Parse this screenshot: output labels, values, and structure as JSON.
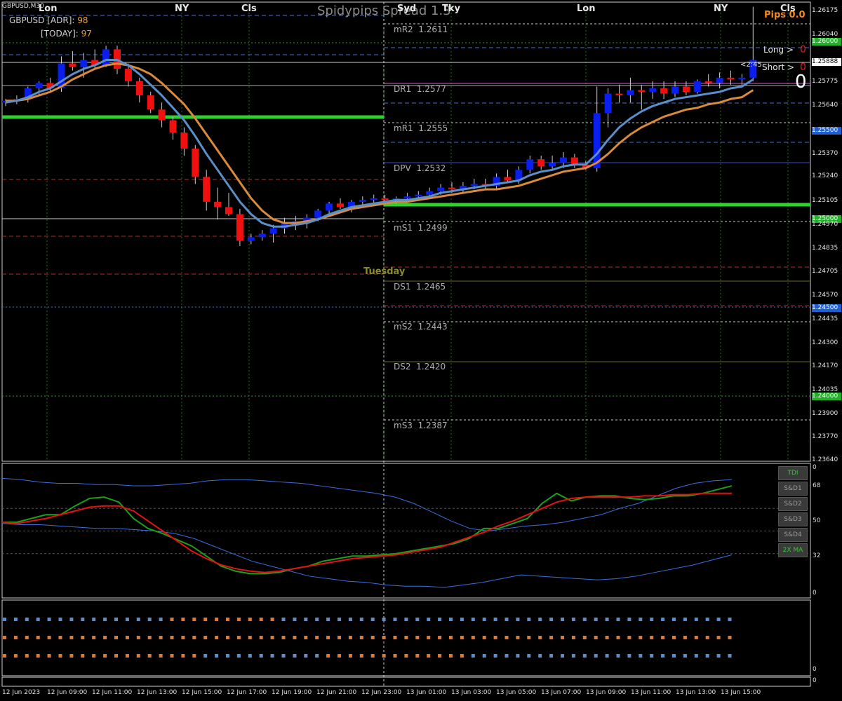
{
  "header": {
    "symbol": "GBPUSD,M30",
    "adr_label": "GBPUSD [ADR]:",
    "adr_value": "98",
    "today_label": "[TODAY]:",
    "today_value": "97",
    "title": "Spidypips Spread 1.3",
    "pips": "Pips 0.0"
  },
  "sessions": [
    "Lon",
    "NY",
    "Cls",
    "Syd",
    "Tky",
    "Lon",
    "NY",
    "Cls"
  ],
  "day_label": "Tuesday",
  "levels": [
    {
      "name": "mR2",
      "value": "1.2611"
    },
    {
      "name": "DR1",
      "value": "1.2577"
    },
    {
      "name": "mR1",
      "value": "1.2555"
    },
    {
      "name": "DPV",
      "value": "1.2532"
    },
    {
      "name": "mS1",
      "value": "1.2499"
    },
    {
      "name": "DS1",
      "value": "1.2465"
    },
    {
      "name": "mS2",
      "value": "1.2443"
    },
    {
      "name": "DS2",
      "value": "1.2420"
    },
    {
      "name": "mS3",
      "value": "1.2387"
    }
  ],
  "trade_panel": {
    "long_label": "Long >",
    "long_value": "0",
    "short_label": "Short >",
    "short_value": "0",
    "timer": "<2:45",
    "big_zero": "0"
  },
  "price_axis": [
    "1.26175",
    "1.26040",
    "1.26000",
    "1.25888",
    "1.25775",
    "1.25640",
    "1.25500",
    "1.25370",
    "1.25240",
    "1.25105",
    "1.25000",
    "1.24970",
    "1.24835",
    "1.24705",
    "1.24570",
    "1.24500",
    "1.24435",
    "1.24300",
    "1.24170",
    "1.24035",
    "1.24000",
    "1.23900",
    "1.23770",
    "1.23640"
  ],
  "price_axis_highlights": {
    "1.26000": "green",
    "1.25888": "white",
    "1.25500": "blue",
    "1.25000": "green",
    "1.24500": "blue",
    "1.24000": "green"
  },
  "time_axis": [
    "12 Jun 2023",
    "12 Jun 09:00",
    "12 Jun 11:00",
    "12 Jun 13:00",
    "12 Jun 15:00",
    "12 Jun 17:00",
    "12 Jun 19:00",
    "12 Jun 21:00",
    "12 Jun 23:00",
    "13 Jun 01:00",
    "13 Jun 03:00",
    "13 Jun 05:00",
    "13 Jun 07:00",
    "13 Jun 09:00",
    "13 Jun 11:00",
    "13 Jun 13:00",
    "13 Jun 15:00"
  ],
  "tdi_axis": [
    "0",
    "68",
    "50",
    "32",
    "0"
  ],
  "tdi_buttons": [
    "TDI",
    "S&D1",
    "S&D2",
    "S&D3",
    "S&D4",
    "2X MA"
  ],
  "bottom_axis": [
    "0",
    "0"
  ],
  "colors": {
    "bull": "#0a1ef0",
    "bear": "#f01010",
    "ma_fast": "#5b8fc9",
    "ma_slow": "#d98a3a",
    "zone_green": "#2fd02f",
    "tdi_green": "#1aa01a",
    "tdi_red": "#e81010",
    "tdi_blue": "#3a6fe0"
  },
  "chart_data": {
    "type": "candlestick",
    "timeframe": "M30",
    "ylim": [
      1.2364,
      1.2618
    ],
    "candles": [
      [
        1.2566,
        1.2568,
        1.2564,
        1.2567
      ],
      [
        1.2567,
        1.257,
        1.2565,
        1.2568
      ],
      [
        1.2568,
        1.2575,
        1.2566,
        1.2574
      ],
      [
        1.2574,
        1.2578,
        1.257,
        1.2577
      ],
      [
        1.2577,
        1.258,
        1.2572,
        1.2574
      ],
      [
        1.2574,
        1.2592,
        1.2572,
        1.2588
      ],
      [
        1.2588,
        1.2595,
        1.2584,
        1.2586
      ],
      [
        1.2586,
        1.2594,
        1.258,
        1.259
      ],
      [
        1.259,
        1.2596,
        1.2585,
        1.2587
      ],
      [
        1.2587,
        1.2598,
        1.2586,
        1.2596
      ],
      [
        1.2596,
        1.2598,
        1.2582,
        1.2585
      ],
      [
        1.2585,
        1.2588,
        1.2575,
        1.2578
      ],
      [
        1.2578,
        1.258,
        1.2566,
        1.257
      ],
      [
        1.257,
        1.2572,
        1.256,
        1.2562
      ],
      [
        1.2562,
        1.2566,
        1.2552,
        1.2556
      ],
      [
        1.2556,
        1.2558,
        1.2545,
        1.2549
      ],
      [
        1.2549,
        1.2552,
        1.2536,
        1.254
      ],
      [
        1.254,
        1.2542,
        1.252,
        1.2524
      ],
      [
        1.2524,
        1.2528,
        1.2505,
        1.251
      ],
      [
        1.251,
        1.2518,
        1.25,
        1.2507
      ],
      [
        1.2507,
        1.2515,
        1.2502,
        1.2503
      ],
      [
        1.2503,
        1.2506,
        1.2485,
        1.2488
      ],
      [
        1.2488,
        1.2492,
        1.2486,
        1.249
      ],
      [
        1.249,
        1.2494,
        1.2488,
        1.2492
      ],
      [
        1.2492,
        1.2497,
        1.2487,
        1.2495
      ],
      [
        1.2495,
        1.2501,
        1.2492,
        1.2498
      ],
      [
        1.2498,
        1.2502,
        1.2494,
        1.2499
      ],
      [
        1.2499,
        1.2503,
        1.2495,
        1.2501
      ],
      [
        1.2501,
        1.2506,
        1.2499,
        1.2505
      ],
      [
        1.2505,
        1.251,
        1.2502,
        1.2509
      ],
      [
        1.2509,
        1.2512,
        1.2506,
        1.2507
      ],
      [
        1.2507,
        1.2511,
        1.2504,
        1.251
      ],
      [
        1.251,
        1.2513,
        1.2508,
        1.2511
      ],
      [
        1.2511,
        1.2514,
        1.2509,
        1.2512
      ],
      [
        1.2512,
        1.2514,
        1.251,
        1.2511
      ],
      [
        1.2511,
        1.2513,
        1.2509,
        1.2512
      ],
      [
        1.2512,
        1.2515,
        1.251,
        1.2513
      ],
      [
        1.2513,
        1.2516,
        1.2511,
        1.2514
      ],
      [
        1.2514,
        1.2518,
        1.2512,
        1.2516
      ],
      [
        1.2516,
        1.252,
        1.2514,
        1.2518
      ],
      [
        1.2518,
        1.2521,
        1.2515,
        1.2517
      ],
      [
        1.2517,
        1.2521,
        1.2515,
        1.2519
      ],
      [
        1.2519,
        1.2523,
        1.2517,
        1.252
      ],
      [
        1.252,
        1.2523,
        1.2517,
        1.2519
      ],
      [
        1.2519,
        1.2526,
        1.2517,
        1.2524
      ],
      [
        1.2524,
        1.2528,
        1.2521,
        1.2522
      ],
      [
        1.2522,
        1.253,
        1.252,
        1.2528
      ],
      [
        1.2528,
        1.2536,
        1.2526,
        1.2534
      ],
      [
        1.2534,
        1.2536,
        1.2528,
        1.253
      ],
      [
        1.253,
        1.2536,
        1.2528,
        1.2532
      ],
      [
        1.2532,
        1.2538,
        1.2529,
        1.2535
      ],
      [
        1.2535,
        1.2537,
        1.2529,
        1.2531
      ],
      [
        1.2531,
        1.2533,
        1.2528,
        1.2529
      ],
      [
        1.2529,
        1.2575,
        1.2527,
        1.256
      ],
      [
        1.256,
        1.2574,
        1.2552,
        1.2571
      ],
      [
        1.2571,
        1.2576,
        1.2566,
        1.257
      ],
      [
        1.257,
        1.258,
        1.2566,
        1.2573
      ],
      [
        1.2573,
        1.2576,
        1.2562,
        1.2572
      ],
      [
        1.2572,
        1.2578,
        1.2568,
        1.2574
      ],
      [
        1.2574,
        1.2578,
        1.2568,
        1.2571
      ],
      [
        1.2571,
        1.2578,
        1.2569,
        1.2575
      ],
      [
        1.2575,
        1.2578,
        1.257,
        1.2572
      ],
      [
        1.2572,
        1.2579,
        1.2571,
        1.2578
      ],
      [
        1.2578,
        1.2582,
        1.2575,
        1.2577
      ],
      [
        1.2577,
        1.2583,
        1.2574,
        1.258
      ],
      [
        1.258,
        1.2584,
        1.2576,
        1.2579
      ],
      [
        1.2579,
        1.2582,
        1.2575,
        1.258
      ],
      [
        1.258,
        1.262,
        1.2578,
        1.259
      ]
    ],
    "ma_fast": [
      1.2566,
      1.2567,
      1.2569,
      1.2572,
      1.2574,
      1.2578,
      1.2582,
      1.2585,
      1.2587,
      1.259,
      1.259,
      1.2587,
      1.2582,
      1.2576,
      1.257,
      1.2563,
      1.2556,
      1.2547,
      1.2537,
      1.2528,
      1.2519,
      1.251,
      1.2503,
      1.2498,
      1.2496,
      1.2496,
      1.2497,
      1.2498,
      1.25,
      1.2503,
      1.2505,
      1.2507,
      1.2508,
      1.2509,
      1.251,
      1.2511,
      1.2511,
      1.2512,
      1.2513,
      1.2515,
      1.2516,
      1.2517,
      1.2518,
      1.2519,
      1.252,
      1.2521,
      1.2522,
      1.2525,
      1.2527,
      1.2528,
      1.253,
      1.2531,
      1.2531,
      1.2537,
      1.2545,
      1.2552,
      1.2557,
      1.2561,
      1.2564,
      1.2566,
      1.2568,
      1.2569,
      1.257,
      1.2571,
      1.2572,
      1.2574,
      1.2575,
      1.2579
    ],
    "ma_slow": [
      1.2567,
      1.2567,
      1.2568,
      1.257,
      1.2572,
      1.2575,
      1.2579,
      1.2582,
      1.2585,
      1.2587,
      1.2588,
      1.2587,
      1.2585,
      1.2582,
      1.2577,
      1.2571,
      1.2565,
      1.2557,
      1.2548,
      1.2539,
      1.253,
      1.2521,
      1.2512,
      1.2505,
      1.25,
      1.2498,
      1.2498,
      1.2499,
      1.25,
      1.2502,
      1.2504,
      1.2506,
      1.2507,
      1.2508,
      1.2509,
      1.251,
      1.251,
      1.2511,
      1.2512,
      1.2513,
      1.2514,
      1.2515,
      1.2516,
      1.2517,
      1.2517,
      1.2518,
      1.2519,
      1.2521,
      1.2523,
      1.2525,
      1.2527,
      1.2528,
      1.2529,
      1.2532,
      1.2537,
      1.2543,
      1.2548,
      1.2552,
      1.2555,
      1.2558,
      1.256,
      1.2562,
      1.2563,
      1.2565,
      1.2566,
      1.2568,
      1.2569,
      1.2573
    ]
  }
}
